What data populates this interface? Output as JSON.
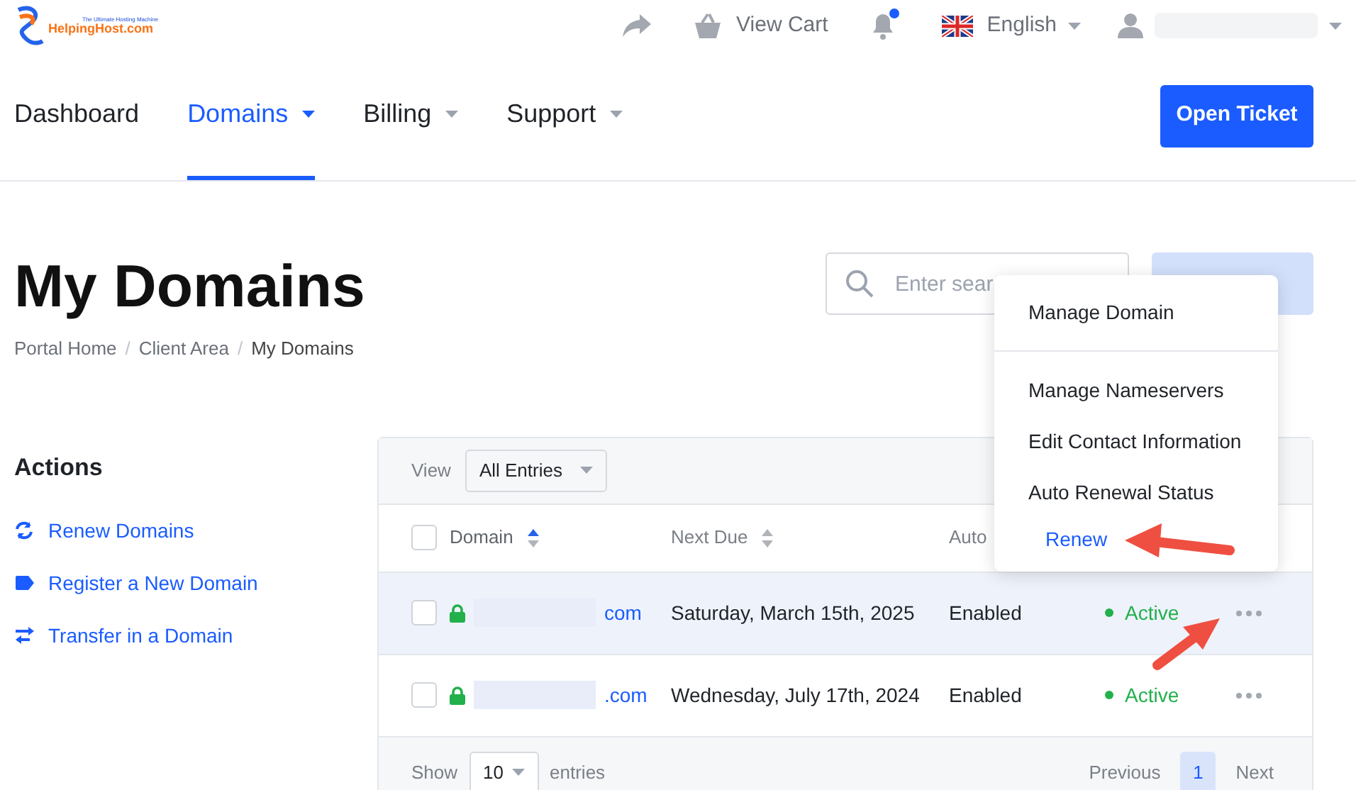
{
  "topbar": {
    "logo": {
      "tagline": "The Ultimate Hosting Machine",
      "name": "HelpingHost.com"
    },
    "cart": "View Cart",
    "notifications_unread": true,
    "language": "English"
  },
  "nav": {
    "items": [
      {
        "label": "Dashboard",
        "selected": false,
        "dropdown": false
      },
      {
        "label": "Domains",
        "selected": true,
        "dropdown": true
      },
      {
        "label": "Billing",
        "selected": false,
        "dropdown": true
      },
      {
        "label": "Support",
        "selected": false,
        "dropdown": true
      }
    ],
    "cta": "Open Ticket"
  },
  "page": {
    "title": "My Domains",
    "breadcrumb": [
      "Portal Home",
      "Client Area",
      "My Domains"
    ],
    "breadcrumb_separator": "/",
    "search": {
      "placeholder": "Enter sear"
    }
  },
  "actions": {
    "title": "Actions",
    "items": [
      {
        "kind": "renew",
        "label": "Renew Domains"
      },
      {
        "kind": "register",
        "label": "Register a New Domain"
      },
      {
        "kind": "transfer",
        "label": "Transfer in a Domain"
      }
    ]
  },
  "table": {
    "view_label": "View",
    "view_value": "All Entries",
    "select_all_checked": false,
    "columns": [
      {
        "label": "Domain",
        "sortable": true,
        "sorted": true
      },
      {
        "label": "Next Due",
        "sortable": true,
        "sorted": false
      },
      {
        "label": "Auto",
        "sortable": false,
        "sorted": false
      }
    ],
    "rows": [
      {
        "checked": false,
        "domain": "com",
        "next_due": "Saturday, March 15th, 2025",
        "auto": "Enabled",
        "status": "Active",
        "highlighted": true
      },
      {
        "checked": false,
        "domain": ".com",
        "next_due": "Wednesday, July 17th, 2024",
        "auto": "Enabled",
        "status": "Active",
        "highlighted": false
      }
    ],
    "show_label": "Show",
    "show_value": "10",
    "entries_label": "entries",
    "pagination": {
      "previous": "Previous",
      "pages": [
        {
          "label": "1",
          "selected": true
        }
      ],
      "next": "Next"
    }
  },
  "menu": {
    "items": [
      {
        "label": "Manage Domain",
        "kind": "item"
      },
      {
        "kind": "divider"
      },
      {
        "label": "Manage Nameservers",
        "kind": "item"
      },
      {
        "label": "Edit Contact Information",
        "kind": "item"
      },
      {
        "label": "Auto Renewal Status",
        "kind": "item"
      },
      {
        "label": "Renew",
        "kind": "link"
      }
    ]
  }
}
